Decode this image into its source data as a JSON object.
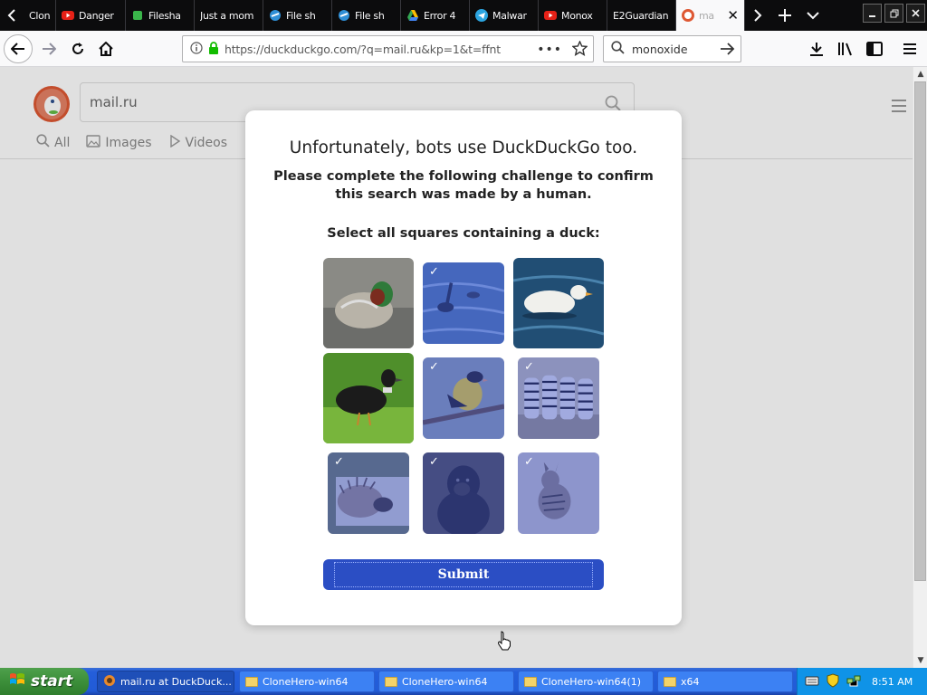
{
  "browser": {
    "tabs": [
      {
        "label": "Clone H",
        "icon": "page-icon",
        "active": false
      },
      {
        "label": "Danger",
        "icon": "youtube-icon",
        "active": false
      },
      {
        "label": "Filesha",
        "icon": "filesharing-icon",
        "active": false
      },
      {
        "label": "Just a mom",
        "icon": "none",
        "active": false
      },
      {
        "label": "File sh",
        "icon": "file-share-icon",
        "active": false
      },
      {
        "label": "File sh",
        "icon": "file-share-icon",
        "active": false
      },
      {
        "label": "Error 4",
        "icon": "google-drive-icon",
        "active": false
      },
      {
        "label": "Malwar",
        "icon": "telegram-icon",
        "active": false
      },
      {
        "label": "Monox",
        "icon": "youtube-icon",
        "active": false
      },
      {
        "label": "E2Guardian",
        "icon": "none",
        "active": false
      },
      {
        "label": "ma",
        "icon": "duckduckgo-icon",
        "active": true
      }
    ],
    "url": "https://duckduckgo.com/?q=mail.ru&kp=1&t=ffnt",
    "search_value": "monoxide"
  },
  "ddg": {
    "query": "mail.ru",
    "tabs": [
      {
        "label": "All",
        "icon": "search-icon"
      },
      {
        "label": "Images",
        "icon": "image-icon"
      },
      {
        "label": "Videos",
        "icon": "play-icon"
      }
    ]
  },
  "challenge": {
    "title": "Unfortunately, bots use DuckDuckGo too.",
    "description": "Please complete the following challenge to confirm this search was made by a human.",
    "prompt": "Select all squares containing a duck:",
    "submit_label": "Submit",
    "tiles": [
      {
        "subject": "teal-duck-photo",
        "selected": false
      },
      {
        "subject": "water-birds-photo",
        "selected": true
      },
      {
        "subject": "white-duck-photo",
        "selected": false
      },
      {
        "subject": "black-duck-photo",
        "selected": false
      },
      {
        "subject": "goldfinch-photo",
        "selected": true
      },
      {
        "subject": "zebras-photo",
        "selected": true
      },
      {
        "subject": "hedgehog-photo",
        "selected": true
      },
      {
        "subject": "gorilla-photo",
        "selected": true
      },
      {
        "subject": "hyena-photo",
        "selected": true
      }
    ]
  },
  "taskbar": {
    "start_label": "start",
    "items": [
      {
        "label": "mail.ru at DuckDuck...",
        "active": true
      },
      {
        "label": "CloneHero-win64",
        "active": false
      },
      {
        "label": "CloneHero-win64",
        "active": false
      },
      {
        "label": "CloneHero-win64(1)",
        "active": false
      },
      {
        "label": "x64",
        "active": false
      }
    ],
    "clock": "8:51 AM"
  },
  "colors": {
    "submit": "#2b4ec4",
    "selection_tint": "#3c50dc",
    "ddg_orange": "#de5833",
    "taskbar_blue": "#245edb"
  }
}
